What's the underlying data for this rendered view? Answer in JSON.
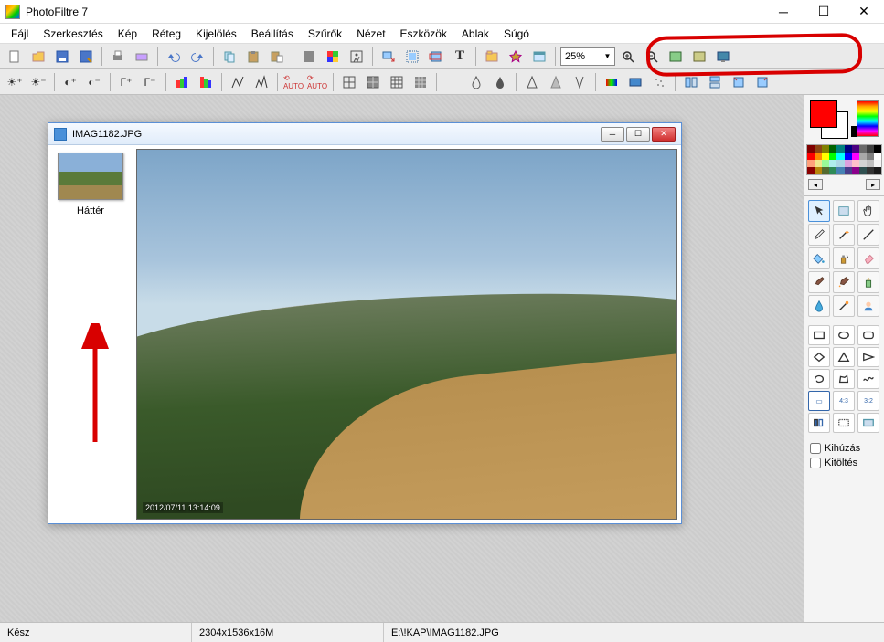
{
  "title": "PhotoFiltre 7",
  "menu": [
    "Fájl",
    "Szerkesztés",
    "Kép",
    "Réteg",
    "Kijelölés",
    "Beállítás",
    "Szűrők",
    "Nézet",
    "Eszközök",
    "Ablak",
    "Súgó"
  ],
  "zoom": {
    "value": "25%"
  },
  "image_window": {
    "title": "IMAG1182.JPG",
    "layer_label": "Háttér",
    "watermark": "2012/07/11 13:14:09"
  },
  "status": {
    "ready": "Kész",
    "dims": "2304x1536x16M",
    "path": "E:\\!KAP\\IMAG1182.JPG"
  },
  "options": {
    "check1_label": "Kihúzás",
    "check2_label": "Kitöltés"
  },
  "toolbar1": {
    "new": "new-icon",
    "open": "open-icon",
    "save": "save-icon",
    "saveas": "saveas-icon",
    "print": "print-icon",
    "twain": "twain-icon",
    "undo": "undo-icon",
    "redo": "redo-icon",
    "copy": "copy-icon",
    "paste": "paste-icon",
    "pastenew": "pastenew-icon",
    "rgb": "rgb-icon",
    "swatches": "swatches-icon",
    "histogram": "histogram-icon",
    "imgsize": "imgsize-icon",
    "canvassize": "canvassize-icon",
    "crop": "crop-icon",
    "text": "text-icon",
    "explore": "explore-icon",
    "auto": "auto-icon",
    "module": "module-icon",
    "zoomin": "zoomin-icon",
    "zoomout": "zoomout-icon",
    "fit": "fit-icon",
    "autofit": "autofit-icon",
    "full": "full-icon"
  },
  "toolbar2": {
    "b1": "bright+",
    "b2": "bright-",
    "b3": "contrast+",
    "b4": "contrast-",
    "b5": "gamma+",
    "b6": "gamma-",
    "b7": "sat+",
    "b8": "sat-",
    "b9": "hist1",
    "b10": "hist2",
    "b11": "autolevel",
    "b12": "autocontrast",
    "b13": "grid1",
    "b14": "grid2",
    "b15": "grid3",
    "b16": "grid4",
    "b17": "gray",
    "b18": "drop1",
    "b19": "drop2",
    "b20": "sharpen",
    "b21": "blur",
    "b22": "var",
    "b23": "color1",
    "b24": "color2",
    "b25": "dust",
    "b26": "fliph",
    "b27": "flipv",
    "b28": "rot1",
    "b29": "rot2"
  },
  "palette_colors": [
    "#800000",
    "#8b4513",
    "#808000",
    "#006400",
    "#008080",
    "#000080",
    "#4b0082",
    "#696969",
    "#404040",
    "#000000",
    "#ff0000",
    "#ff8c00",
    "#ffff00",
    "#00ff00",
    "#00ffff",
    "#0000ff",
    "#ff00ff",
    "#a9a9a9",
    "#808080",
    "#ffffff",
    "#ffa07a",
    "#f0e68c",
    "#98fb98",
    "#afeeee",
    "#add8e6",
    "#dda0dd",
    "#ffc0cb",
    "#d3d3d3",
    "#c0c0c0",
    "#f5f5f5",
    "#8b0000",
    "#b8860b",
    "#556b2f",
    "#2e8b57",
    "#4682b4",
    "#483d8b",
    "#8b008b",
    "#2f4f4f",
    "#333333",
    "#1a1a1a"
  ]
}
